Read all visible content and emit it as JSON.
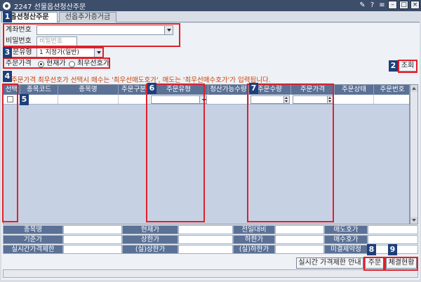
{
  "window": {
    "title": "2247 선물옵션청산주문"
  },
  "tabs": [
    {
      "label": "옵션청산주문",
      "active": true
    },
    {
      "label": "선옵추가증거금",
      "active": false
    }
  ],
  "form": {
    "account_label": "계좌번호",
    "account_value": "",
    "password_label": "비밀번호",
    "password_placeholder": "비밀번호",
    "order_type_label": "문유형",
    "order_type_value": "1 지정가(일반)",
    "order_price_label": "주문가격",
    "price_option_current": "현재가",
    "price_option_best": "최우선호가",
    "price_option_selected": "현재가"
  },
  "notice": "최우선호가 선택시 매수는 '최우선매도호가', 매도는 '최우선매수호가'가 입력됩니다.",
  "notice_prefix": "주문가격",
  "buttons": {
    "lookup": "조회",
    "realtime_limit_info": "실시간 가격제한 안내",
    "order": "주문",
    "execution_status": "체결현황"
  },
  "grid": {
    "columns": [
      "선택",
      "종목코드",
      "종목명",
      "주문구분",
      "주문유형",
      "청산가능수량",
      "주문수량",
      "주문가격",
      "주문상태",
      "주문번호"
    ]
  },
  "info": {
    "row1": [
      "종목명",
      "현재가",
      "전일대비",
      "매도호가"
    ],
    "row2": [
      "기준가",
      "상한가",
      "하한가",
      "매수호가"
    ],
    "row3": [
      "실시간가격제한",
      "(실)상한가",
      "(실)하한가",
      "미결제약정"
    ]
  },
  "annotations": [
    "1",
    "2",
    "3",
    "4",
    "5",
    "6",
    "7",
    "8",
    "9"
  ],
  "colors": {
    "title_bar": "#3c4e6a",
    "grid_header": "#5b7196",
    "grid_body": "#c6d2e4",
    "highlight": "#e0202a",
    "marker": "#1d3f7a",
    "notice_text": "#c8400a"
  },
  "icons": [
    "app-logo-icon",
    "pin-icon",
    "help-icon",
    "menu-icon",
    "minimize-icon",
    "maximize-icon",
    "close-icon"
  ]
}
